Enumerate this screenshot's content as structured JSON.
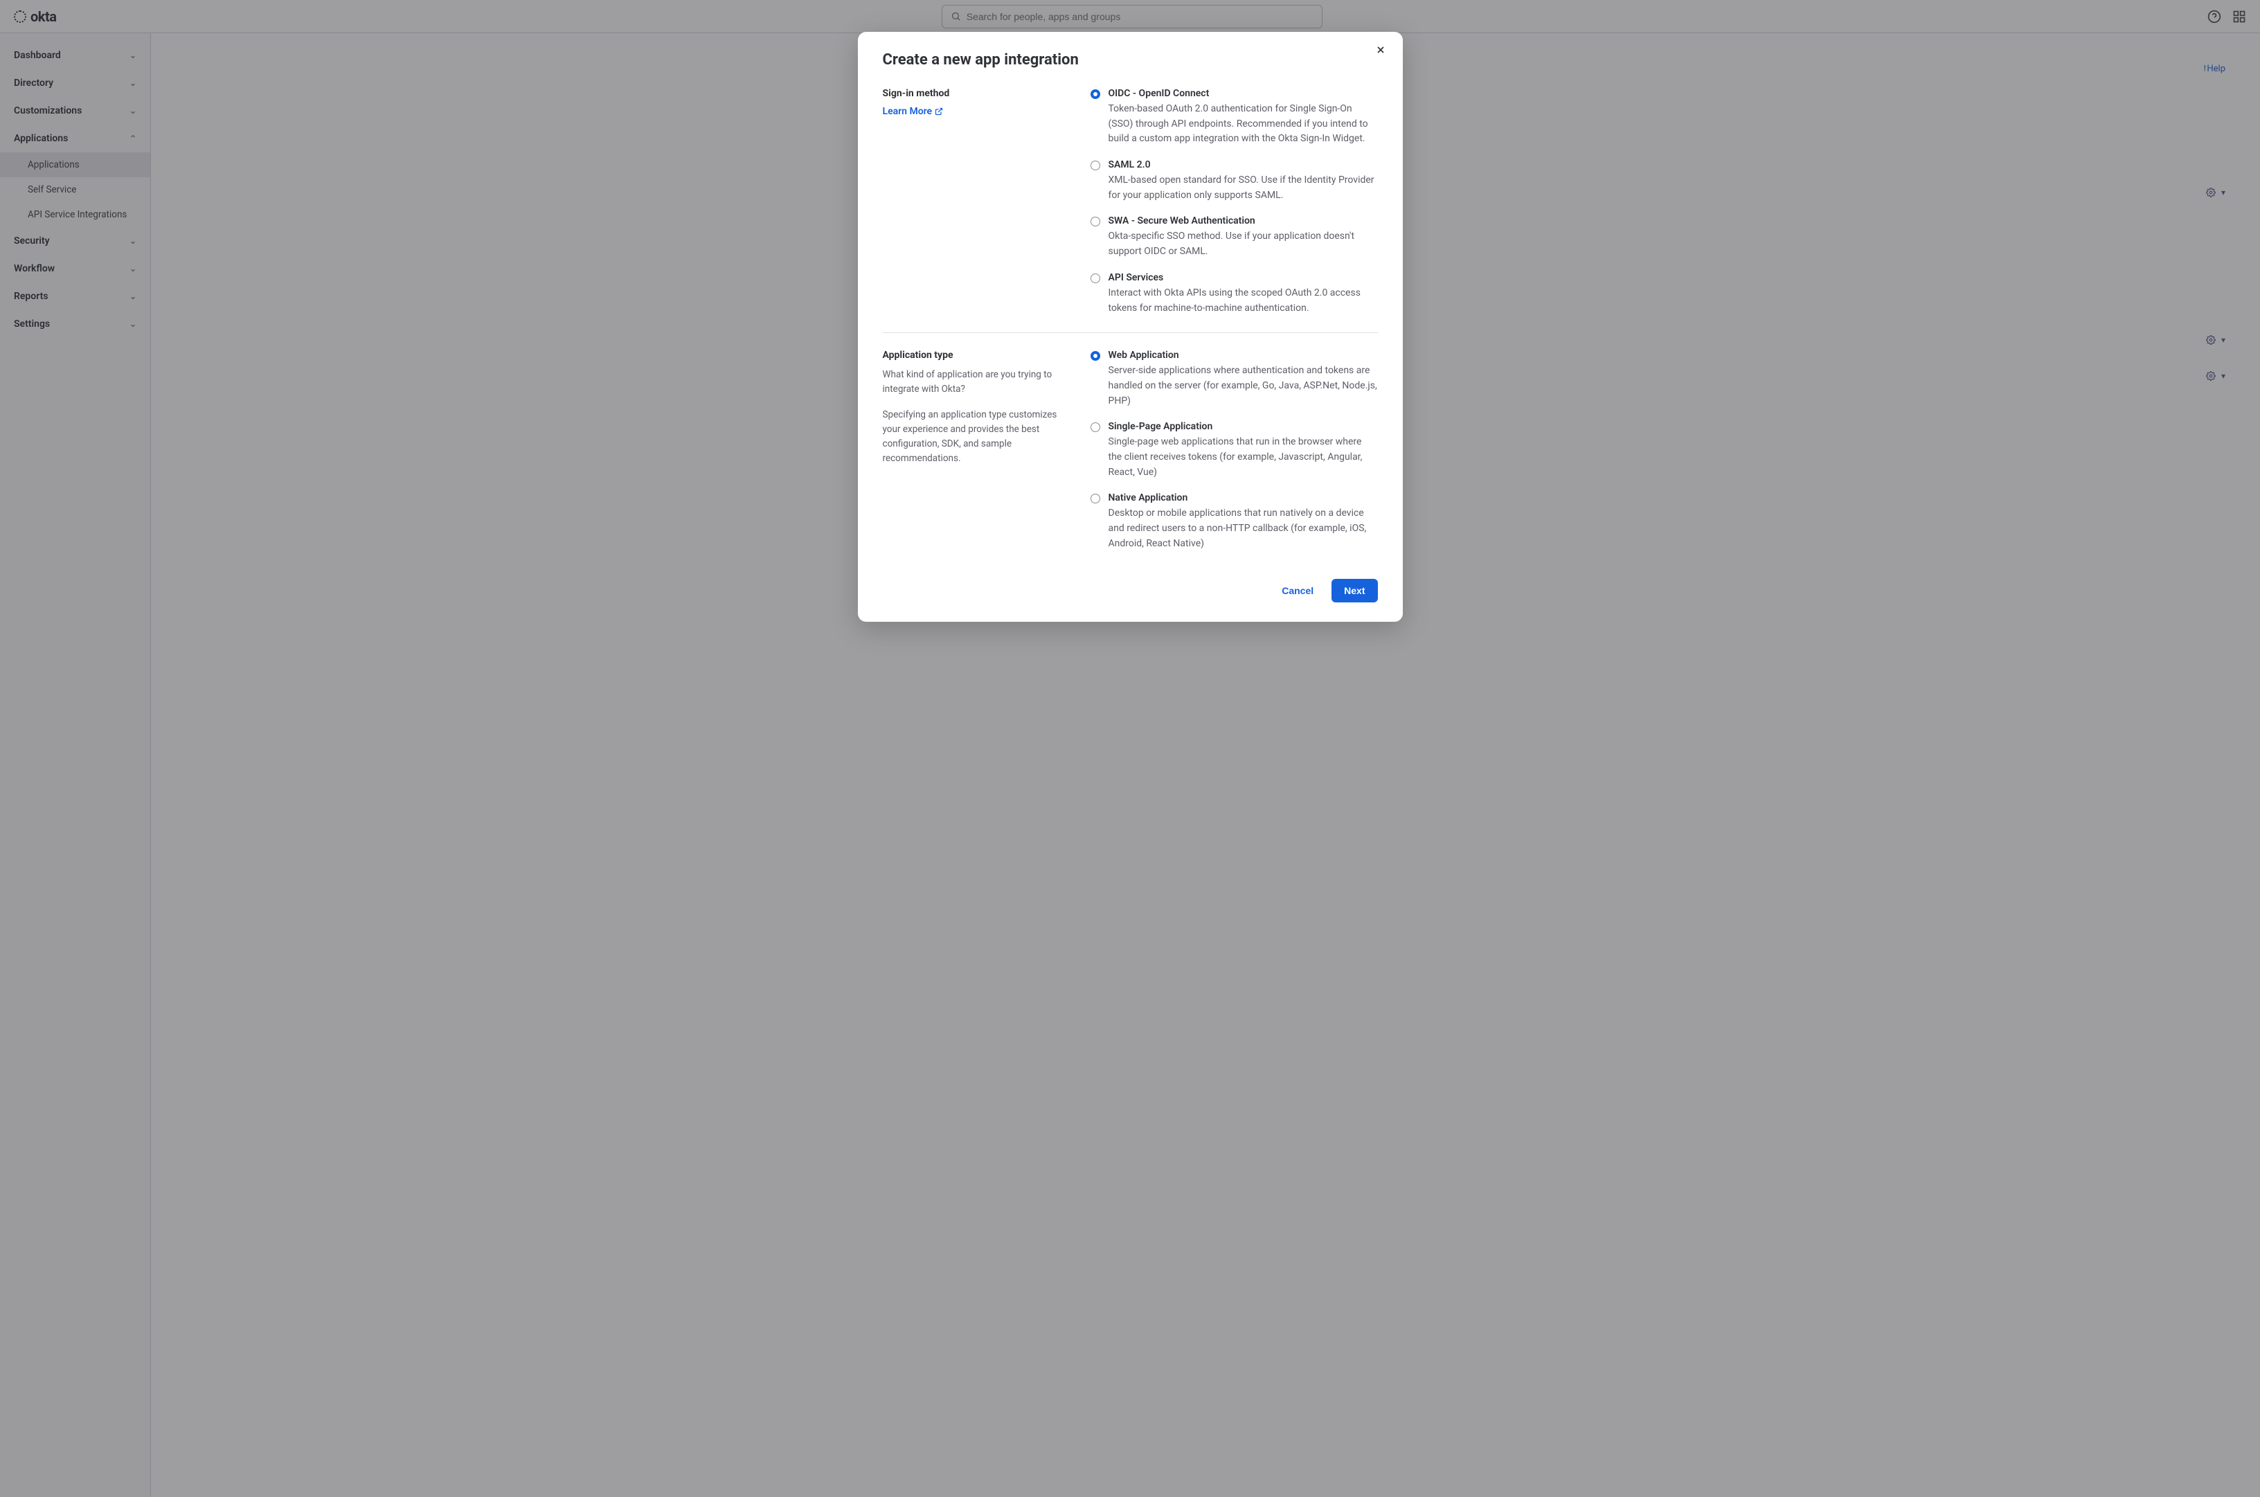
{
  "brand": "okta",
  "search": {
    "placeholder": "Search for people, apps and groups"
  },
  "sidebar": {
    "items": [
      {
        "label": "Dashboard",
        "expanded": false
      },
      {
        "label": "Directory",
        "expanded": false
      },
      {
        "label": "Customizations",
        "expanded": false
      },
      {
        "label": "Applications",
        "expanded": true
      },
      {
        "label": "Security",
        "expanded": false
      },
      {
        "label": "Workflow",
        "expanded": false
      },
      {
        "label": "Reports",
        "expanded": false
      },
      {
        "label": "Settings",
        "expanded": false
      }
    ],
    "subitems": [
      {
        "label": "Applications",
        "active": true
      },
      {
        "label": "Self Service",
        "active": false
      },
      {
        "label": "API Service Integrations",
        "active": false
      }
    ]
  },
  "help_link": "Help",
  "modal": {
    "title": "Create a new app integration",
    "section1": {
      "heading": "Sign-in method",
      "learn_more": "Learn More",
      "options": [
        {
          "title": "OIDC - OpenID Connect",
          "desc": "Token-based OAuth 2.0 authentication for Single Sign-On (SSO) through API endpoints. Recommended if you intend to build a custom app integration with the Okta Sign-In Widget.",
          "selected": true
        },
        {
          "title": "SAML 2.0",
          "desc": "XML-based open standard for SSO. Use if the Identity Provider for your application only supports SAML.",
          "selected": false
        },
        {
          "title": "SWA - Secure Web Authentication",
          "desc": "Okta-specific SSO method. Use if your application doesn't support OIDC or SAML.",
          "selected": false
        },
        {
          "title": "API Services",
          "desc": "Interact with Okta APIs using the scoped OAuth 2.0 access tokens for machine-to-machine authentication.",
          "selected": false
        }
      ]
    },
    "section2": {
      "heading": "Application type",
      "help1": "What kind of application are you trying to integrate with Okta?",
      "help2": "Specifying an application type customizes your experience and provides the best configuration, SDK, and sample recommendations.",
      "options": [
        {
          "title": "Web Application",
          "desc": "Server-side applications where authentication and tokens are handled on the server (for example, Go, Java, ASP.Net, Node.js, PHP)",
          "selected": true
        },
        {
          "title": "Single-Page Application",
          "desc": "Single-page web applications that run in the browser where the client receives tokens (for example, Javascript, Angular, React, Vue)",
          "selected": false
        },
        {
          "title": "Native Application",
          "desc": "Desktop or mobile applications that run natively on a device and redirect users to a non-HTTP callback (for example, iOS, Android, React Native)",
          "selected": false
        }
      ]
    },
    "cancel": "Cancel",
    "next": "Next"
  }
}
